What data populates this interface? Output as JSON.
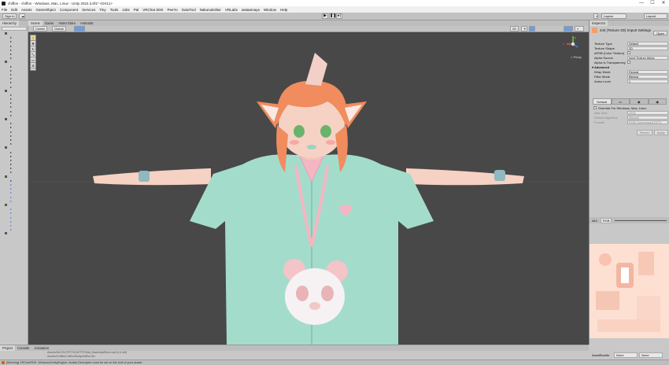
{
  "window": {
    "title": "chiffon - chiffon - Windows, Mac, Linux - Unity 2022.3.6f1* <DX11>",
    "controls": [
      "—",
      "☐",
      "✕"
    ]
  },
  "menu": [
    "File",
    "Edit",
    "Assets",
    "GameObject",
    "Component",
    "Services",
    "Tiny",
    "Tools",
    "Jobs",
    "Pal",
    "VRChat SDK",
    "PeeYo",
    "GatoTool",
    "NakunoEditor",
    "VRLabs",
    "wataamaya",
    "Window",
    "Help"
  ],
  "toolbar": {
    "account": "Sign In",
    "layers": "Layers",
    "layout": "Layout"
  },
  "hierarchy": {
    "tab": "Hierarchy"
  },
  "scene": {
    "tabs": [
      "Scene",
      "Game",
      "Asset Store",
      "Animator"
    ],
    "pivot": "Center",
    "space": "Global",
    "view_2d": "2D",
    "persp_label": "< Persp",
    "view_axes": {
      "x": "x",
      "y": "y",
      "z": "z"
    }
  },
  "inspector": {
    "tab": "Inspector",
    "title": "444 (Texture 2D) Import Settings",
    "open": "Open",
    "props": [
      {
        "label": "Texture Type",
        "value": "Default"
      },
      {
        "label": "Texture Shape",
        "value": "2D"
      },
      {
        "label": "sRGB (Color Texture)",
        "check": true
      },
      {
        "label": "Alpha Source",
        "value": "Input Texture Alpha"
      },
      {
        "label": "Alpha Is Transparency",
        "check": true
      },
      {
        "label": "▾ Advanced",
        "section": true
      },
      {
        "label": "Wrap Mode",
        "value": "Repeat"
      },
      {
        "label": "Filter Mode",
        "value": "Bilinear"
      },
      {
        "label": "Aniso Level",
        "value": "1"
      }
    ],
    "platform_tabs": [
      "Default",
      "▭",
      "◉",
      "◉"
    ],
    "override": "Override For Windows, Mac, Linux",
    "platform_props": [
      {
        "label": "Max Size",
        "value": "2048"
      },
      {
        "label": "Resize Algorithm",
        "value": "Mitchell"
      },
      {
        "label": "Format",
        "value": "RGB Compressed DXT1"
      }
    ],
    "revert": "Revert",
    "apply": "Apply",
    "preview_label": "444",
    "preview_value": "RGB",
    "asset_labels": "AssetBundle",
    "asset_none_1": "None",
    "asset_none_2": "None"
  },
  "bottom": {
    "tabs": [
      "Project",
      "Console",
      "Animation"
    ],
    "console_line_1": "Assets/KAI.OUTFITS/OUTFIT/Mat_Materials/Bum.mat (4.4 mb)",
    "console_line_2": "Assets/Outfits/Chiffon/Body/chiffon.fbx"
  },
  "status": {
    "message": "[Warning] VRChatSDK: Windows/UnityEngine: Avatar Descriptor must be set on the root of your avatar"
  },
  "colors": {
    "viewport_bg": "#484848",
    "skin": "#f6d2c4",
    "hair": "#f08c5e",
    "jacket": "#a4dccb",
    "accent_pink": "#f4b6c2"
  }
}
